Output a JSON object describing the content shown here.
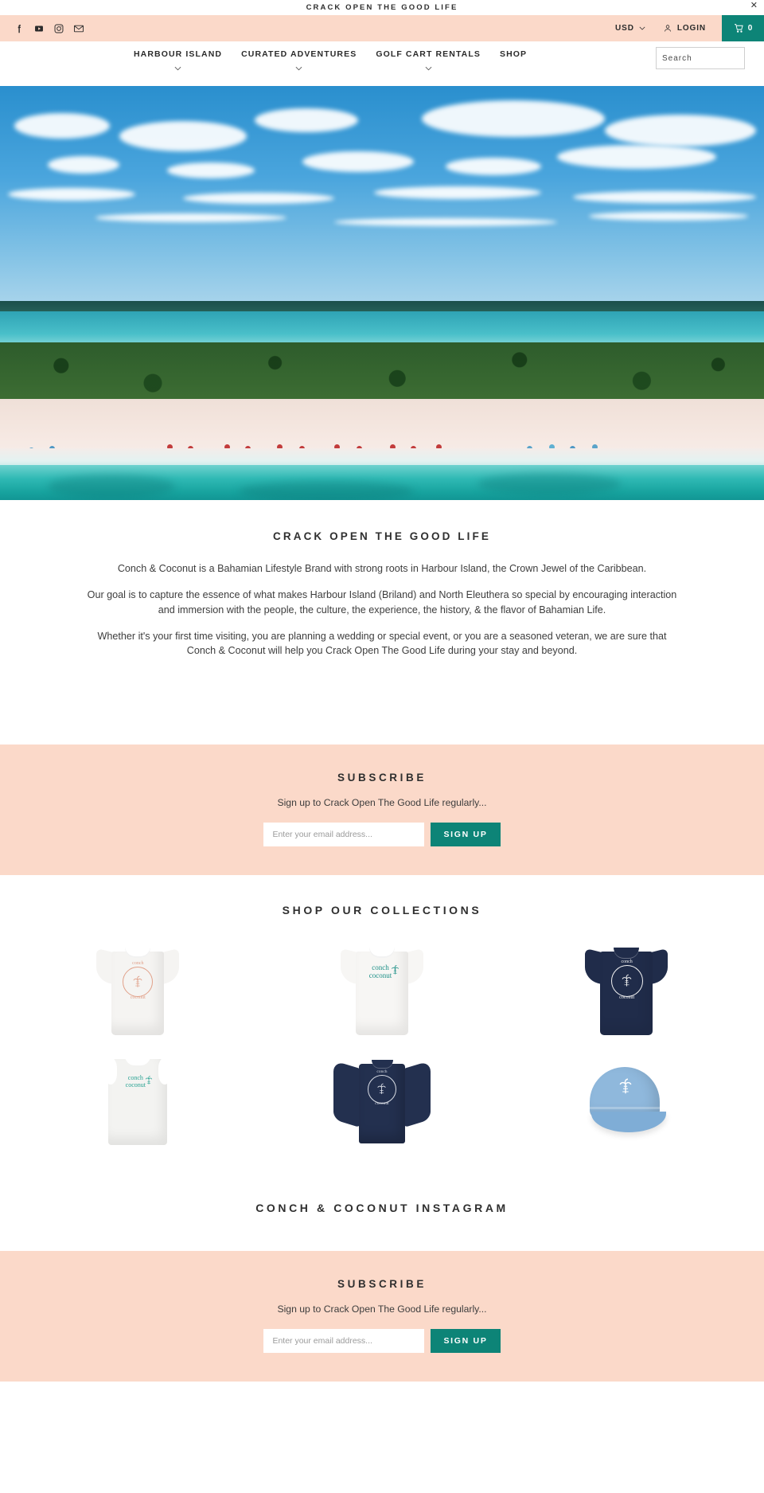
{
  "announcement": {
    "text": "CRACK OPEN THE GOOD LIFE",
    "close_label": "✕"
  },
  "utility_bar": {
    "social": [
      {
        "name": "facebook-icon",
        "label": "Facebook"
      },
      {
        "name": "youtube-icon",
        "label": "YouTube"
      },
      {
        "name": "instagram-icon",
        "label": "Instagram"
      },
      {
        "name": "email-icon",
        "label": "Email"
      }
    ],
    "currency": "USD",
    "login_label": "LOGIN",
    "cart_count": "0",
    "accent_color": "#0d8477",
    "bar_color": "#fbd9c9"
  },
  "nav": {
    "items": [
      {
        "label": "HARBOUR ISLAND",
        "has_dropdown": true
      },
      {
        "label": "CURATED ADVENTURES",
        "has_dropdown": true
      },
      {
        "label": "GOLF CART RENTALS",
        "has_dropdown": true
      },
      {
        "label": "SHOP",
        "has_dropdown": false
      }
    ]
  },
  "search": {
    "placeholder": "Search",
    "value": ""
  },
  "hero": {
    "alt": "Aerial view of Harbour Island pink sand beach with turquoise water"
  },
  "about": {
    "heading": "CRACK OPEN THE GOOD LIFE",
    "paragraphs": [
      "Conch & Coconut is a Bahamian Lifestyle Brand with strong roots in Harbour Island, the Crown Jewel of the Caribbean.",
      "Our goal is to capture the essence of what makes Harbour Island (Briland) and North Eleuthera so special by encouraging interaction and immersion with the people, the culture, the experience, the history, & the flavor of Bahamian Life.",
      "Whether it's your first time visiting, you are planning a wedding or special event, or you are a seasoned veteran, we are sure that Conch & Coconut will help you Crack Open The Good Life during your stay and beyond."
    ]
  },
  "subscribe_top": {
    "heading": "SUBSCRIBE",
    "subtext": "Sign up to Crack Open The Good Life regularly...",
    "placeholder": "Enter your email address...",
    "value": "",
    "button_label": "SIGN UP"
  },
  "collections": {
    "heading": "SHOP OUR COLLECTIONS",
    "products": [
      {
        "name": "white-tee-coral-logo",
        "garment": "tee",
        "color": "#f5f4f2",
        "print_color": "#e1a18a",
        "logo": "circle",
        "brand_top": "conch",
        "brand_bottom": "coconut"
      },
      {
        "name": "white-tee-teal-logo",
        "garment": "tee",
        "color": "#f7f6f4",
        "print_color": "#1b8f86",
        "logo": "stacked",
        "brand_top": "conch",
        "brand_bottom": "coconut"
      },
      {
        "name": "navy-tee-white-logo",
        "garment": "tee",
        "color": "#202c4a",
        "print_color": "#f2f2f2",
        "logo": "circle",
        "brand_top": "conch",
        "brand_bottom": "coconut"
      },
      {
        "name": "white-tank-teal-logo",
        "garment": "tank",
        "color": "#f3f3f1",
        "print_color": "#2aa393",
        "logo": "stacked",
        "brand_top": "conch",
        "brand_bottom": "coconut"
      },
      {
        "name": "navy-long-sleeve-white-logo",
        "garment": "long-sleeve",
        "color": "#23304f",
        "print_color": "#d9dde5",
        "logo": "circle",
        "brand_top": "conch",
        "brand_bottom": "coconut"
      },
      {
        "name": "light-blue-cap-white-logo",
        "garment": "cap",
        "color": "#8fb8dc",
        "print_color": "#ffffff",
        "logo": "palm",
        "brand_top": "",
        "brand_bottom": ""
      }
    ]
  },
  "instagram": {
    "heading": "CONCH & COCONUT INSTAGRAM"
  },
  "subscribe_bottom": {
    "heading": "SUBSCRIBE",
    "subtext": "Sign up to Crack Open The Good Life regularly...",
    "placeholder": "Enter your email address...",
    "value": "",
    "button_label": "SIGN UP"
  }
}
